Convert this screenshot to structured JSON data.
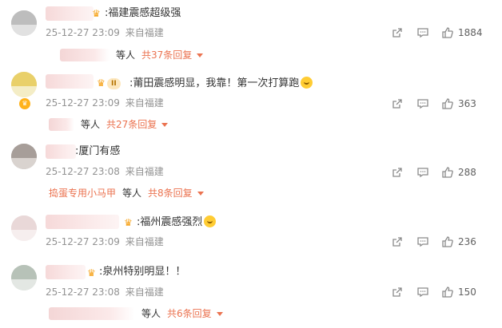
{
  "comments": [
    {
      "text": ":福建震感超级强",
      "time": "25-12-27 23:09",
      "source": "来自福建",
      "likes": "1884",
      "reply": {
        "by": "等人",
        "total": "共37条回复",
        "name": ""
      }
    },
    {
      "badge": "II",
      "text": ":莆田震感明显，我靠！第一次打算跑",
      "time": "25-12-27 23:09",
      "source": "来自福建",
      "likes": "363",
      "reply": {
        "by": "等人",
        "total": "共27条回复",
        "name": ""
      }
    },
    {
      "text": ":厦门有感",
      "time": "25-12-27 23:08",
      "source": "来自福建",
      "likes": "288",
      "reply": {
        "by": "等人",
        "total": "共8条回复",
        "name": "捣蛋专用小马甲"
      }
    },
    {
      "text": ":福州震感强烈",
      "time": "25-12-27 23:09",
      "source": "来自福建",
      "likes": "236",
      "reply": null
    },
    {
      "text": ":泉州特别明显！！",
      "time": "25-12-27 23:08",
      "source": "来自福建",
      "likes": "150",
      "reply": {
        "by": "等人",
        "total": "共6条回复",
        "name": ""
      }
    }
  ],
  "icons": {
    "share": "share-icon",
    "comment": "comment-icon",
    "like": "like-icon",
    "expand": "triangle-down-icon",
    "vip": "crown-icon"
  },
  "colors": {
    "accent": "#eb7350",
    "meta": "#939393",
    "crown": "#f6a21a"
  }
}
